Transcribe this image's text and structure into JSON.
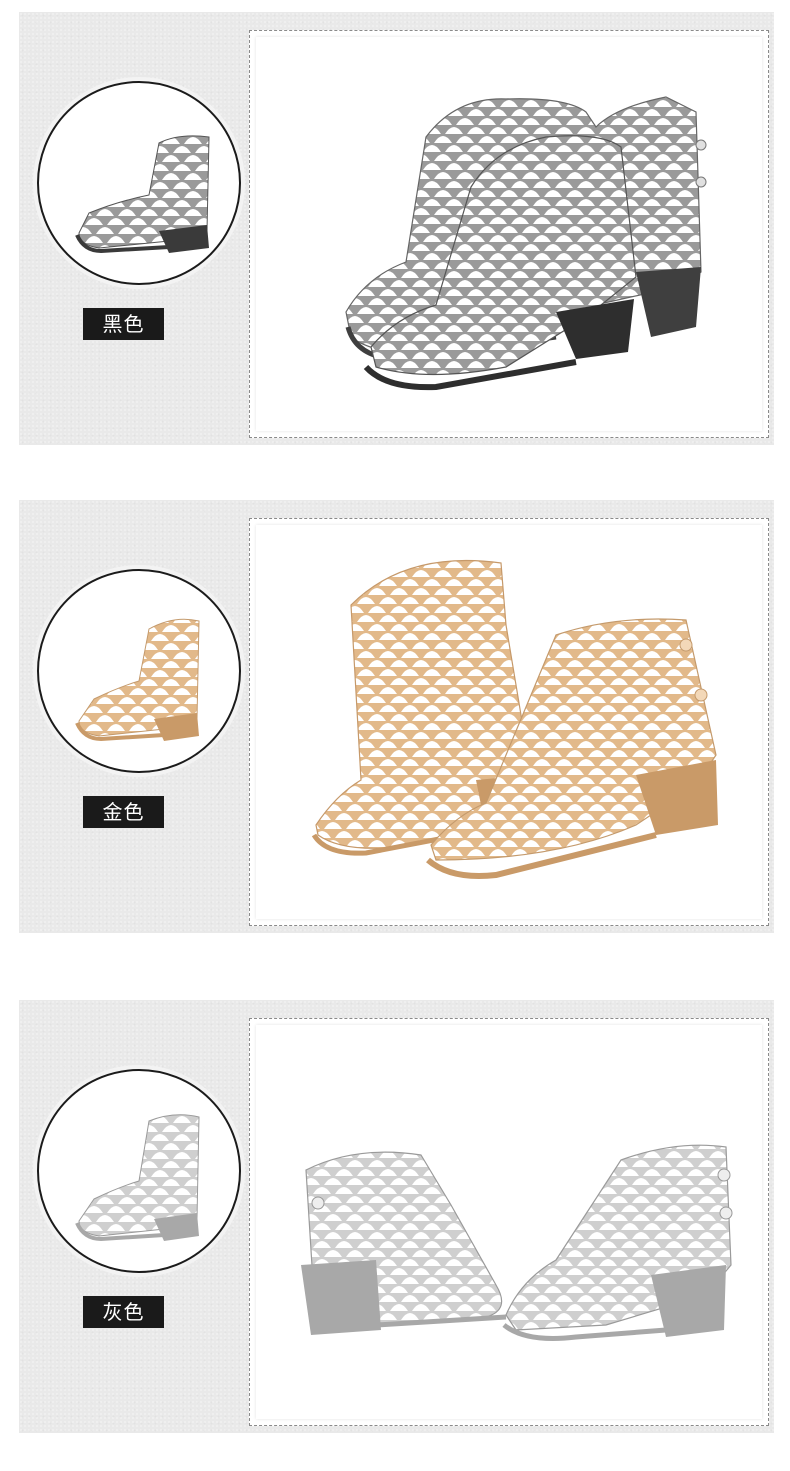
{
  "variants": [
    {
      "label": "黑色",
      "icon": "jelly-wedge-sandal-black",
      "colors": {
        "body": "#9a9a9a",
        "light": "#d6d6d6",
        "dark": "#3a3a3a",
        "sole": "#4a4a4a"
      }
    },
    {
      "label": "金色",
      "icon": "jelly-wedge-sandal-gold",
      "colors": {
        "body": "#e2b98a",
        "light": "#f4dcc0",
        "dark": "#b07c47",
        "sole": "#c99a68"
      }
    },
    {
      "label": "灰色",
      "icon": "jelly-wedge-sandal-grey",
      "colors": {
        "body": "#cfcfcf",
        "light": "#efefef",
        "dark": "#8d8d8d",
        "sole": "#a8a8a8"
      }
    }
  ]
}
